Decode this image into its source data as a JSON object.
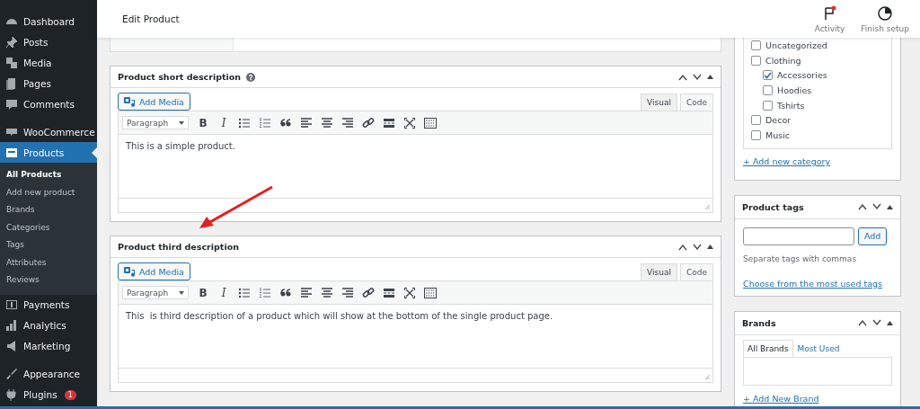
{
  "sidebar": {
    "groups": [
      [
        {
          "label": "Dashboard",
          "selected": false
        },
        {
          "label": "Posts",
          "selected": false
        },
        {
          "label": "Media",
          "selected": false
        },
        {
          "label": "Pages",
          "selected": false
        },
        {
          "label": "Comments",
          "selected": false
        }
      ],
      [
        {
          "label": "WooCommerce",
          "selected": false
        },
        {
          "label": "Products",
          "selected": true,
          "children": [
            {
              "label": "All Products",
              "selected": true
            },
            {
              "label": "Add new product",
              "selected": false
            },
            {
              "label": "Brands",
              "selected": false
            },
            {
              "label": "Categories",
              "selected": false
            },
            {
              "label": "Tags",
              "selected": false
            },
            {
              "label": "Attributes",
              "selected": false
            },
            {
              "label": "Reviews",
              "selected": false
            }
          ]
        },
        {
          "label": "Payments",
          "selected": false
        },
        {
          "label": "Analytics",
          "selected": false
        },
        {
          "label": "Marketing",
          "selected": false
        }
      ],
      [
        {
          "label": "Appearance",
          "selected": false
        },
        {
          "label": "Plugins",
          "selected": false,
          "badge": "1"
        }
      ]
    ]
  },
  "header": {
    "title": "Edit Product",
    "actions": [
      {
        "label": "Activity",
        "kind": "activity",
        "notification": true
      },
      {
        "label": "Finish setup",
        "kind": "setup",
        "notification": false
      }
    ]
  },
  "editors": [
    {
      "title": "Product short description",
      "help": true,
      "add_media": "Add Media",
      "tabs": [
        {
          "label": "Visual",
          "selected": true
        },
        {
          "label": "Code",
          "selected": false
        }
      ],
      "format": "Paragraph",
      "toolbar": [
        {
          "kind": "bold",
          "text": "B"
        },
        {
          "kind": "italic",
          "text": "I"
        },
        {
          "kind": "bullets"
        },
        {
          "kind": "numbers"
        },
        {
          "kind": "quote"
        },
        {
          "kind": "left"
        },
        {
          "kind": "center"
        },
        {
          "kind": "right"
        },
        {
          "kind": "link"
        },
        {
          "kind": "more"
        },
        {
          "kind": "fullscreen"
        },
        {
          "kind": "keyboard"
        }
      ],
      "content": "This is a simple product."
    },
    {
      "title": "Product third description",
      "help": false,
      "add_media": "Add Media",
      "tabs": [
        {
          "label": "Visual",
          "selected": true
        },
        {
          "label": "Code",
          "selected": false
        }
      ],
      "format": "Paragraph",
      "toolbar": [
        {
          "kind": "bold",
          "text": "B"
        },
        {
          "kind": "italic",
          "text": "I"
        },
        {
          "kind": "bullets"
        },
        {
          "kind": "numbers"
        },
        {
          "kind": "quote"
        },
        {
          "kind": "left"
        },
        {
          "kind": "center"
        },
        {
          "kind": "right"
        },
        {
          "kind": "link"
        },
        {
          "kind": "more"
        },
        {
          "kind": "fullscreen"
        },
        {
          "kind": "keyboard"
        }
      ],
      "content": "This  is third description of a product which will show at the bottom of the single product page."
    }
  ],
  "categories": {
    "items": [
      {
        "label": "Uncategorized",
        "checked": false
      },
      {
        "label": "Clothing",
        "checked": false,
        "children": [
          {
            "label": "Accessories",
            "checked": true
          },
          {
            "label": "Hoodies",
            "checked": false
          },
          {
            "label": "Tshirts",
            "checked": false
          }
        ]
      },
      {
        "label": "Decor",
        "checked": false
      },
      {
        "label": "Music",
        "checked": false
      }
    ],
    "add_link": "+ Add new category"
  },
  "tags_panel": {
    "title": "Product tags",
    "button": "Add",
    "hint": "Separate tags with commas",
    "link": "Choose from the most used tags"
  },
  "brands_panel": {
    "title": "Brands",
    "tabs": [
      {
        "label": "All Brands",
        "selected": true
      },
      {
        "label": "Most Used",
        "selected": false
      }
    ],
    "add_link": "+ Add New Brand"
  }
}
